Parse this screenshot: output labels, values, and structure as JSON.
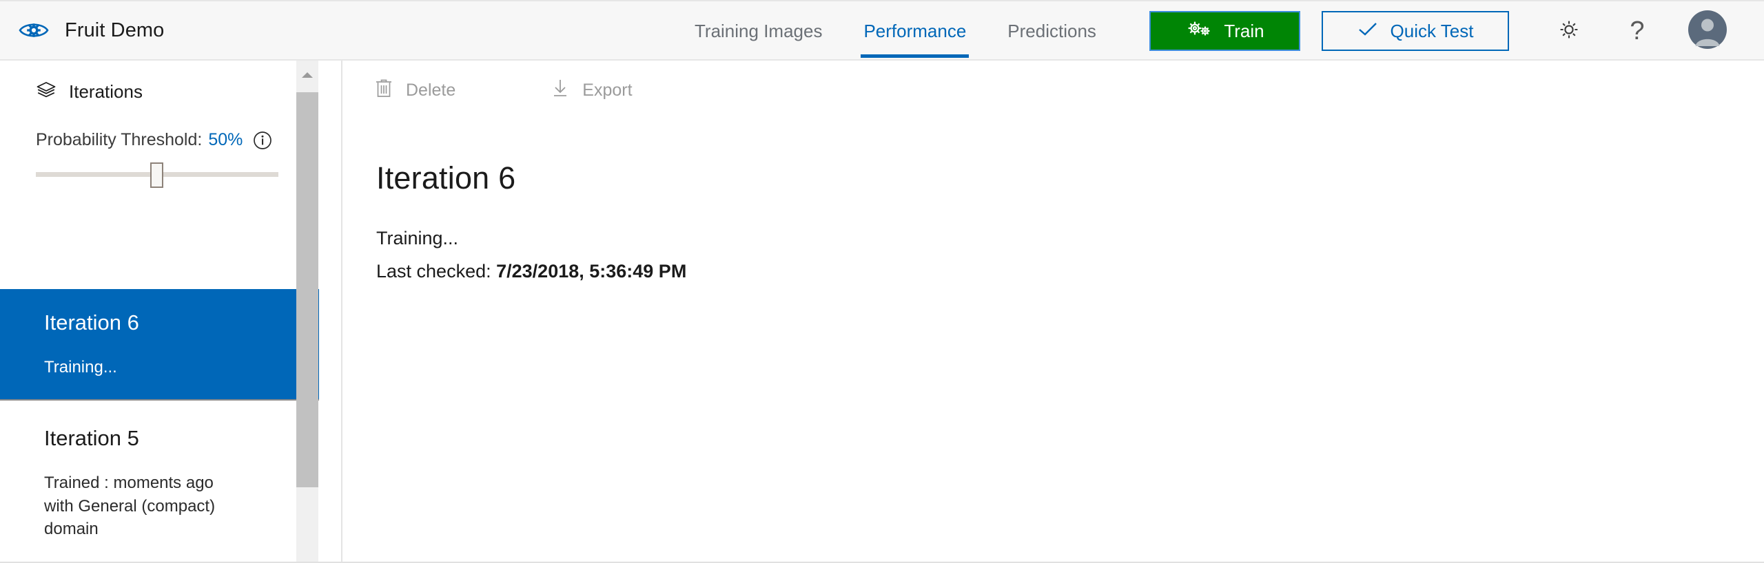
{
  "header": {
    "logo_icon": "eye-gear-logo-icon",
    "title": "Fruit Demo",
    "tabs": [
      {
        "label": "Training Images",
        "active": false
      },
      {
        "label": "Performance",
        "active": true
      },
      {
        "label": "Predictions",
        "active": false
      }
    ],
    "train_button": {
      "label": "Train",
      "icon": "gears-icon",
      "bg_color": "#008505",
      "text_color": "#ffffff"
    },
    "quick_test_button": {
      "label": "Quick Test",
      "icon": "checkmark-icon",
      "border_color": "#0067b8",
      "text_color": "#0067b8"
    },
    "settings_icon": "gear-icon",
    "help_icon": "question-mark-icon",
    "help_glyph": "?",
    "avatar_icon": "user-avatar-icon"
  },
  "sidebar": {
    "heading": "Iterations",
    "heading_icon": "layers-stack-icon",
    "threshold": {
      "label": "Probability Threshold:",
      "value": "50%",
      "info_icon": "info-circle-icon",
      "slider_position_percent": 50,
      "track_color": "#dedad5",
      "value_color": "#0067b8"
    },
    "iterations": [
      {
        "title": "Iteration 6",
        "status": "Training...",
        "selected": true,
        "selected_color": "#0067b8"
      },
      {
        "title": "Iteration 5",
        "status": "Trained : moments ago with General (compact) domain",
        "selected": false
      }
    ],
    "scrollbar": {
      "up_arrow_icon": "chevron-up-icon",
      "thumb_color": "#c1c1c1",
      "track_color": "#f0f0f0"
    }
  },
  "main": {
    "toolbar": {
      "delete_label": "Delete",
      "delete_icon": "trash-icon",
      "export_label": "Export",
      "export_icon": "download-arrow-icon",
      "disabled_color": "#9b9b9b"
    },
    "title": "Iteration 6",
    "status": "Training...",
    "last_checked_label": "Last checked:",
    "last_checked_value": "7/23/2018, 5:36:49 PM"
  }
}
